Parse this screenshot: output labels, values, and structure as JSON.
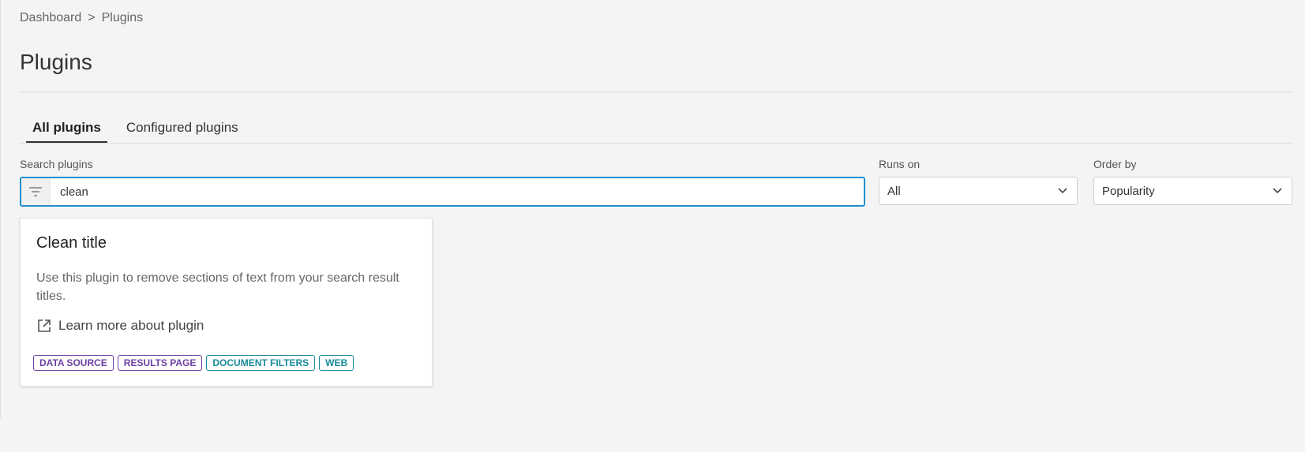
{
  "breadcrumb": {
    "items": [
      "Dashboard",
      "Plugins"
    ],
    "separator": ">"
  },
  "page_title": "Plugins",
  "tabs": [
    {
      "label": "All plugins",
      "active": true
    },
    {
      "label": "Configured plugins",
      "active": false
    }
  ],
  "search": {
    "label": "Search plugins",
    "value": "clean",
    "placeholder": "",
    "icon": "filter-icon"
  },
  "runs_on": {
    "label": "Runs on",
    "value": "All",
    "icon": "chevron-down-icon"
  },
  "order_by": {
    "label": "Order by",
    "value": "Popularity",
    "icon": "chevron-down-icon"
  },
  "plugin_card": {
    "title": "Clean title",
    "description": "Use this plugin to remove sections of text from your search result titles.",
    "link_label": "Learn more about plugin",
    "link_icon": "external-link-icon",
    "tags": [
      {
        "label": "DATA SOURCE",
        "color": "#6b3fa0"
      },
      {
        "label": "RESULTS PAGE",
        "color": "#6b3fa0"
      },
      {
        "label": "DOCUMENT FILTERS",
        "color": "#1a8a9a"
      },
      {
        "label": "WEB",
        "color": "#1a8a9a"
      }
    ]
  },
  "colors": {
    "accent": "#1f8fcf",
    "background": "#f4f4f4",
    "tag_purple": "#6b3fa0",
    "tag_teal": "#1a8a9a"
  }
}
